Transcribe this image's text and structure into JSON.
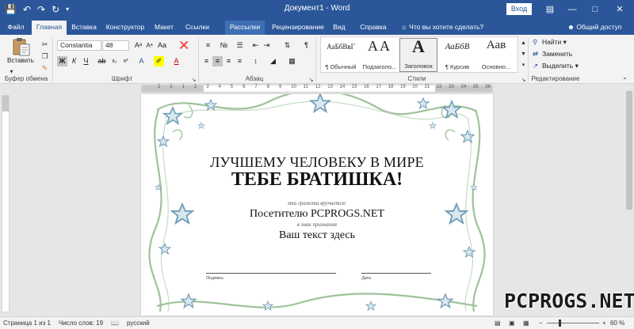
{
  "titlebar": {
    "title": "Документ1 - Word",
    "login_label": "Вход",
    "icons": [
      "save-icon",
      "undo-icon",
      "redo-icon",
      "autosave-icon"
    ]
  },
  "tabs": [
    "Файл",
    "Главная",
    "Вставка",
    "Конструктор",
    "Макет",
    "Ссылки",
    "Рассылки",
    "Рецензирование",
    "Вид",
    "Справка"
  ],
  "active_tab": "Главная",
  "tell_me": "Что вы хотите сделать?",
  "share": "Общий доступ",
  "ribbon": {
    "clipboard": {
      "paste_label": "Вставить",
      "group": "Буфер обмена"
    },
    "font": {
      "name": "Constantia",
      "size": "48",
      "group": "Шрифт",
      "bold": "Ж",
      "italic": "К",
      "underline": "Ч"
    },
    "paragraph": {
      "group": "Абзац"
    },
    "styles": {
      "group": "Стили",
      "items": [
        {
          "sample": "АаБбВвГ",
          "label": "¶ Обычный"
        },
        {
          "sample": "АА",
          "label": "Подзаголо..."
        },
        {
          "sample": "А",
          "label": "Заголовок"
        },
        {
          "sample": "АаБбВ",
          "label": "¶ Курсив"
        },
        {
          "sample": "Аав",
          "label": "Основно..."
        }
      ],
      "selected_index": 2
    },
    "editing": {
      "group": "Редактирование",
      "find": "Найти",
      "replace": "Заменить",
      "select": "Выделить"
    }
  },
  "ruler_numbers": [
    "2",
    "1",
    "1",
    "2",
    "3",
    "4",
    "5",
    "6",
    "7",
    "8",
    "9",
    "10",
    "11",
    "12",
    "13",
    "14",
    "15",
    "16",
    "17",
    "18",
    "19",
    "20",
    "21",
    "22",
    "23",
    "24",
    "25",
    "26"
  ],
  "document": {
    "line1": "ЛУЧШЕМУ ЧЕЛОВЕКУ В МИРЕ",
    "line2": "ТЕБЕ БРАТИШКА!",
    "awarded": "эта грамота вручается:",
    "recipient": "Посетителю PCPROGS.NET",
    "recognition": "в знак признания",
    "your_text": "Ваш текст здесь",
    "signature_label": "Подпись",
    "date_label": "Дата"
  },
  "statusbar": {
    "page": "Страница 1 из 1",
    "words": "Число слов: 19",
    "language": "русский",
    "zoom": "60 %",
    "zoom_percent": 60
  },
  "watermark": "PCPROGS.NET",
  "colors": {
    "accent": "#2b579a",
    "border_green": "#9fc29a",
    "border_star": "#6f9bb5"
  }
}
